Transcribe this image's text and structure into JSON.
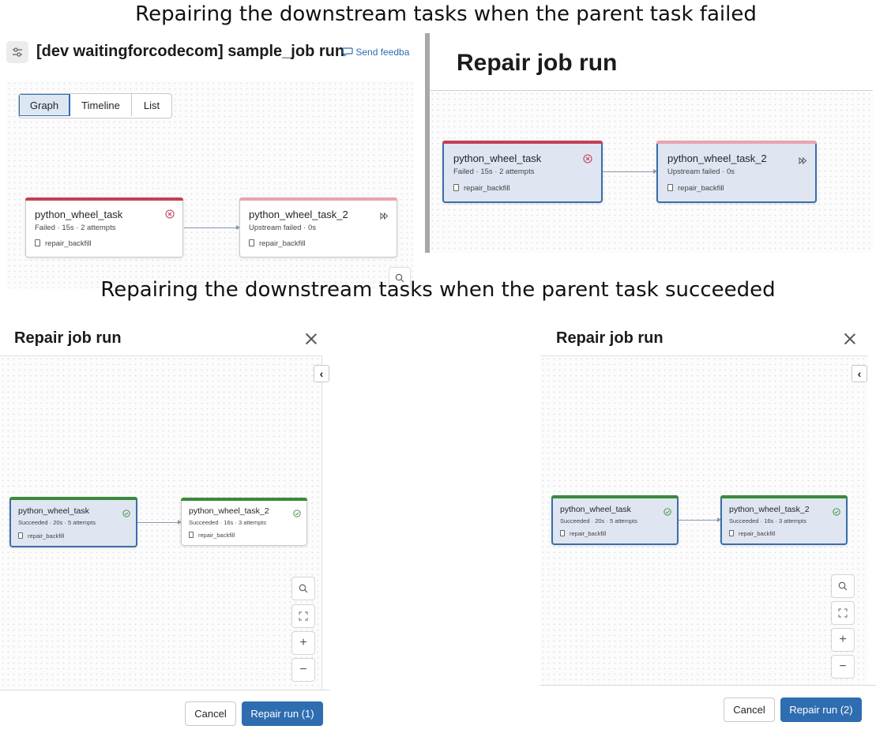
{
  "headings": {
    "top": "Repairing the downstream tasks when the parent task failed",
    "middle": "Repairing the downstream tasks when the parent task succeeded"
  },
  "job_page": {
    "title": "[dev waitingforcodecom] sample_job run",
    "feedback_link": "Send feedba",
    "view_tabs": [
      "Graph",
      "Timeline",
      "List"
    ],
    "active_tab": "Graph",
    "task1": {
      "name": "python_wheel_task",
      "status": "Failed",
      "duration": "15s",
      "attempts": "2 attempts",
      "file": "repair_backfill"
    },
    "task2": {
      "name": "python_wheel_task_2",
      "status": "Upstream failed",
      "duration": "0s",
      "file": "repair_backfill"
    }
  },
  "repair_dialog_failed": {
    "title": "Repair job run",
    "task1": {
      "name": "python_wheel_task",
      "status": "Failed",
      "duration": "15s",
      "attempts": "2 attempts",
      "file": "repair_backfill"
    },
    "task2": {
      "name": "python_wheel_task_2",
      "status": "Upstream failed",
      "duration": "0s",
      "file": "repair_backfill"
    }
  },
  "repair_dialog_1": {
    "title": "Repair job run",
    "task1": {
      "name": "python_wheel_task",
      "status": "Succeeded",
      "duration": "20s",
      "attempts": "5 attempts",
      "file": "repair_backfill"
    },
    "task2": {
      "name": "python_wheel_task_2",
      "status": "Succeeded",
      "duration": "16s",
      "attempts": "3 attempts",
      "file": "repair_backfill"
    },
    "cancel_label": "Cancel",
    "repair_label": "Repair run (1)"
  },
  "repair_dialog_2": {
    "title": "Repair job run",
    "task1": {
      "name": "python_wheel_task",
      "status": "Succeeded",
      "duration": "20s",
      "attempts": "5 attempts",
      "file": "repair_backfill"
    },
    "task2": {
      "name": "python_wheel_task_2",
      "status": "Succeeded",
      "duration": "16s",
      "attempts": "3 attempts",
      "file": "repair_backfill"
    },
    "cancel_label": "Cancel",
    "repair_label": "Repair run (2)"
  },
  "icons": {
    "failed": "x-circle-icon",
    "upstream_failed": "skip-forward-icon",
    "succeeded": "check-circle-icon",
    "file": "file-icon",
    "search": "search-icon",
    "fit": "fit-to-screen-icon",
    "zoom_in": "plus-icon",
    "zoom_out": "minus-icon",
    "collapse": "chevron-left-icon",
    "close": "close-icon",
    "job": "job-settings-icon",
    "feedback": "chat-bubble-icon"
  },
  "colors": {
    "failed": "#c44057",
    "upstream_failed": "#e9a3b1",
    "succeeded": "#3a8a3a",
    "primary": "#2f6db1",
    "selected_bg": "#dfe6f1"
  }
}
